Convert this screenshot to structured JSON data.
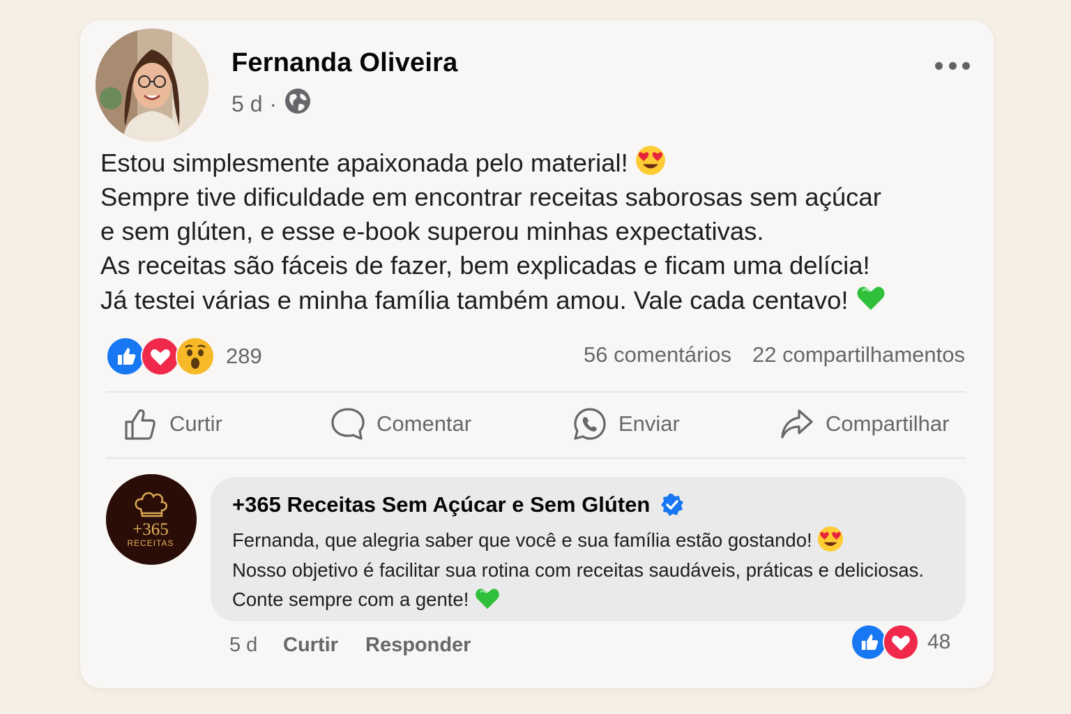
{
  "post": {
    "author": "Fernanda Oliveira",
    "time": "5 d",
    "separator": "·",
    "privacy_icon": "globe-icon",
    "more_icon": "more-horizontal-icon",
    "text_lines": [
      "Estou simplesmente apaixonada pelo material!",
      "Sempre tive dificuldade em encontrar receitas saborosas sem açúcar",
      "e sem glúten, e esse e-book superou minhas expectativas.",
      "As receitas são fáceis de fazer, bem explicadas e ficam uma delícia!",
      "Já testei várias e minha família também amou. Vale cada centavo!"
    ],
    "line1_emoji": "heart-eyes-emoji",
    "line5_emoji": "green-heart-emoji",
    "reactions": [
      "like",
      "love",
      "wow"
    ],
    "reaction_count": "289",
    "comments": "56 comentários",
    "shares": "22 compartilhamentos"
  },
  "actions": {
    "like": "Curtir",
    "comment": "Comentar",
    "send": "Enviar",
    "share": "Compartilhar"
  },
  "reply": {
    "page_name": "+365 Receitas Sem Açúcar e Sem Glúten",
    "verified": true,
    "avatar_text": "+365",
    "avatar_subtext": "RECEITAS",
    "text_lines": [
      "Fernanda, que alegria saber que você e sua família estão gostando!",
      "Nosso objetivo é facilitar sua rotina com receitas saudáveis, práticas e deliciosas.",
      "Conte sempre com a gente!"
    ],
    "time": "5 d",
    "like_label": "Curtir",
    "reply_label": "Responder",
    "reactions": [
      "like",
      "love"
    ],
    "reaction_count": "48"
  },
  "colors": {
    "like_blue": "#1877f2",
    "love_red": "#f02849",
    "wow_yellow": "#f7b928",
    "text_secondary": "#65676b",
    "emoji_green": "#2fbf3a"
  }
}
